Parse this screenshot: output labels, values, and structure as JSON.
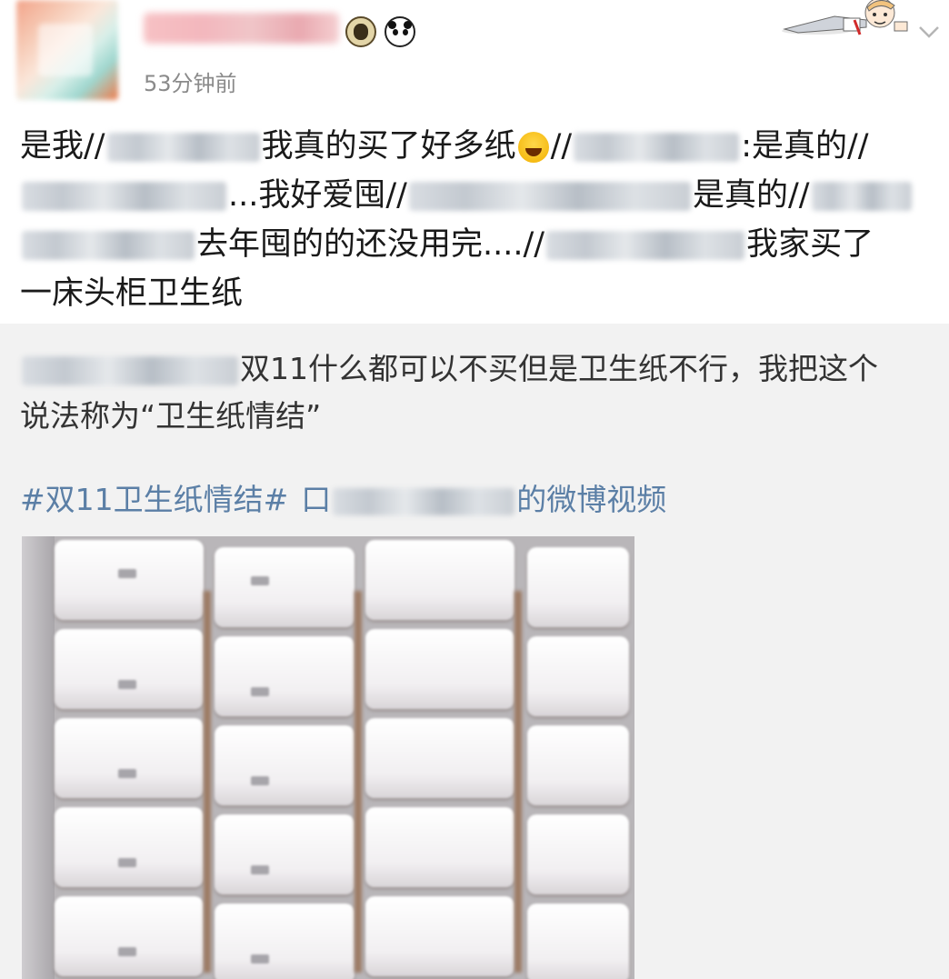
{
  "post": {
    "time": "53分钟前",
    "text_lines": [
      {
        "a": "是我//",
        "b": "我真的买了好多纸",
        "c": "//",
        "d": ":是真的//"
      },
      {
        "a": "...我好爱囤//",
        "b": "是真的//"
      },
      {
        "a": "去年囤的的还没用完....//",
        "b": "我家买了"
      },
      {
        "a": "一床头柜卫生纸"
      }
    ]
  },
  "repost": {
    "text_line1": "双11什么都可以不买但是卫生纸不行，我把这个",
    "text_line2": "说法称为“卫生纸情结”",
    "hashtag": "#双11卫生纸情结#",
    "video_icon": "口",
    "video_suffix": "的微博视频"
  },
  "icons": {
    "sheep_badge": "sheep-icon",
    "panda_badge": "panda-icon",
    "emoji": "laughing-crying-emoji",
    "menu": "chevron-down-icon"
  },
  "colors": {
    "link": "#5b7fa6",
    "time": "#8a8a8a",
    "repost_bg": "#f2f2f2"
  }
}
